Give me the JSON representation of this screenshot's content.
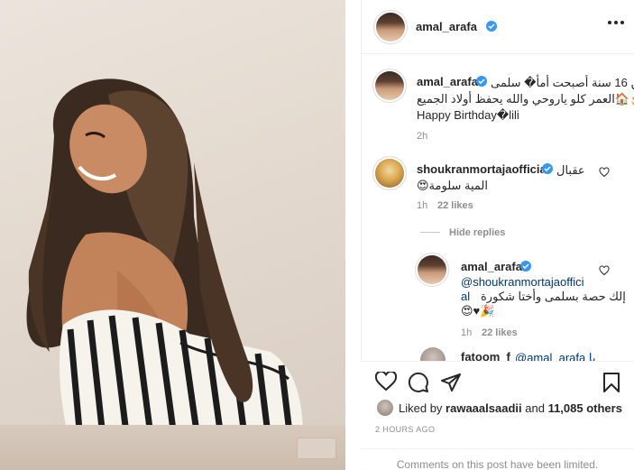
{
  "header": {
    "username": "amal_arafa",
    "more_icon": "more-horizontal-icon"
  },
  "caption": {
    "username": "amal_arafa",
    "line1": "من 16 سنة أصبحت أمأ� سلمى",
    "line2": "🎂🏠العمر كلو ياروحي والله يحفظ أولاد الجميع",
    "line3": "Happy Birthday�lili",
    "time": "2h"
  },
  "comments": [
    {
      "username": "shoukranmortajaofficial",
      "text1": "عقبال",
      "text2": "المية سلومة😍",
      "time": "1h",
      "likes": "22 likes"
    }
  ],
  "hide_replies": "Hide replies",
  "reply": {
    "username": "amal_arafa",
    "mention1": "@shoukranmortajaoffici",
    "mention2": "al",
    "text1": "إلك حصة بسلمى وأختا شكورة",
    "text2": "😍♥🎉",
    "time": "1h",
    "likes": "22 likes"
  },
  "partial_comment": {
    "username": "fatoom_f",
    "text": "@amal_arafa يا"
  },
  "likes": {
    "prefix": "Liked by",
    "user": "rawaaalsaadii",
    "mid": "and",
    "others": "11,085 others"
  },
  "post_time": "2 HOURS AGO",
  "limited_notice": "Comments on this post have been limited.",
  "colors": {
    "verified": "#3897f0",
    "meta": "#8e8e8e",
    "link": "#00376b"
  }
}
